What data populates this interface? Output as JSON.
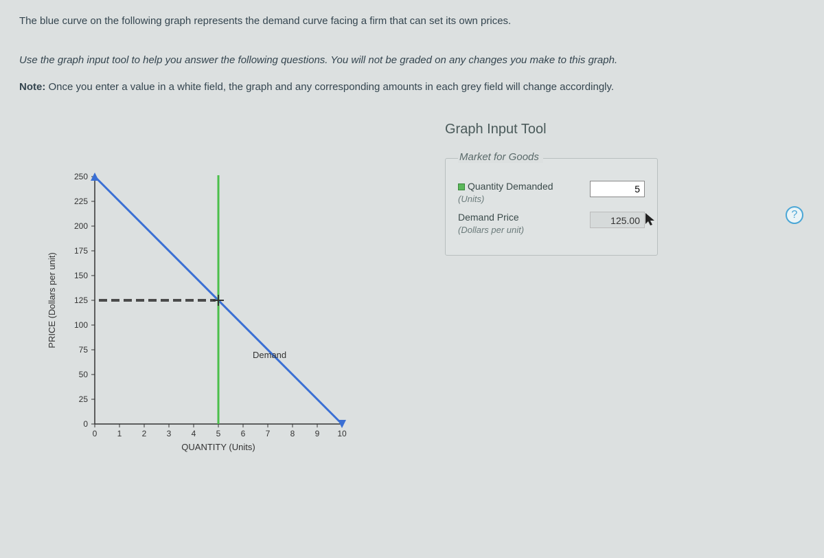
{
  "instructions": {
    "line1": "The blue curve on the following graph represents the demand curve facing a firm that can set its own prices.",
    "line2": "Use the graph input tool to help you answer the following questions. You will not be graded on any changes you make to this graph.",
    "note_label": "Note:",
    "note_text": " Once you enter a value in a white field, the graph and any corresponding amounts in each grey field will change accordingly."
  },
  "tool": {
    "title": "Graph Input Tool",
    "section": "Market for Goods",
    "qty_label": "Quantity Demanded",
    "qty_sub": "(Units)",
    "qty_value": "5",
    "price_label": "Demand Price",
    "price_sub": "(Dollars per unit)",
    "price_value": "125.00"
  },
  "help": "?",
  "chart": {
    "ylabel": "PRICE (Dollars per unit)",
    "xlabel": "QUANTITY (Units)",
    "series_label": "Demand"
  },
  "chart_data": {
    "type": "line",
    "title": "",
    "xlabel": "QUANTITY (Units)",
    "ylabel": "PRICE (Dollars per unit)",
    "xlim": [
      0,
      10
    ],
    "ylim": [
      0,
      250
    ],
    "x_ticks": [
      0,
      1,
      2,
      3,
      4,
      5,
      6,
      7,
      8,
      9,
      10
    ],
    "y_ticks": [
      0,
      25,
      50,
      75,
      100,
      125,
      150,
      175,
      200,
      225,
      250
    ],
    "series": [
      {
        "name": "Demand",
        "x": [
          0,
          1,
          2,
          3,
          4,
          5,
          6,
          7,
          8,
          9,
          10
        ],
        "values": [
          250,
          225,
          200,
          175,
          150,
          125,
          100,
          75,
          50,
          25,
          0
        ]
      }
    ],
    "marker": {
      "quantity": 5,
      "price": 125
    }
  }
}
